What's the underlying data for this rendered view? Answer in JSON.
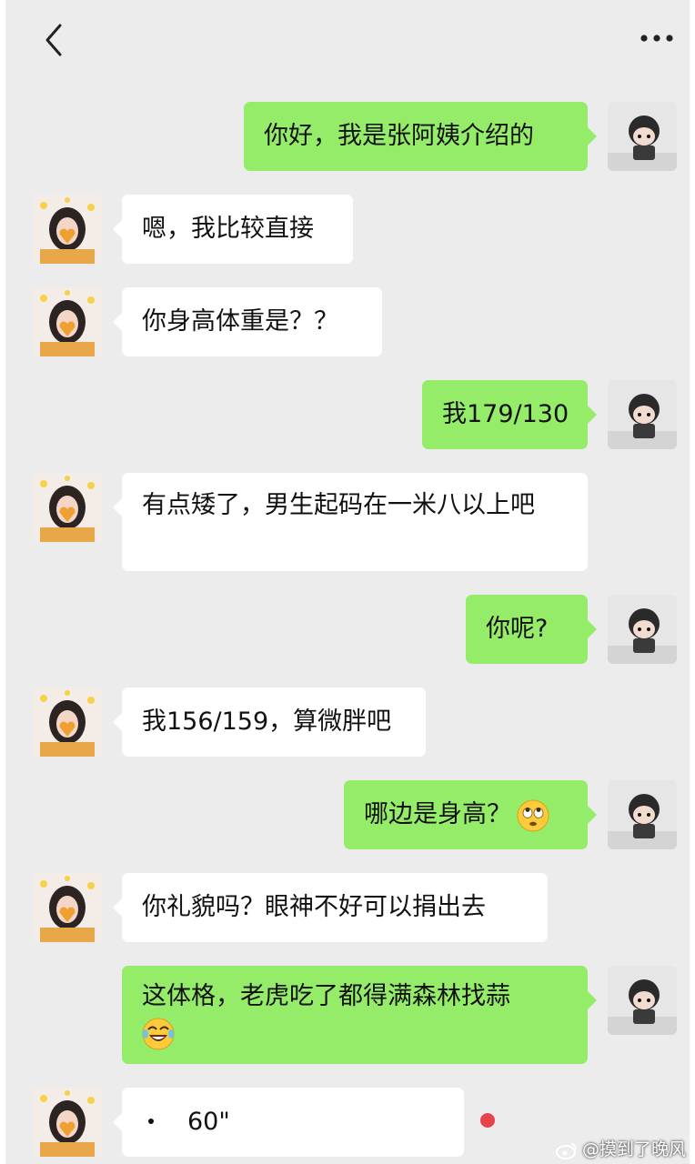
{
  "messages": [
    {
      "text": "你好，我是张阿姨介绍的"
    },
    {
      "text": "嗯，我比较直接"
    },
    {
      "text": "你身高体重是？？"
    },
    {
      "text": "我179/130"
    },
    {
      "text": "有点矮了，男生起码在一米八以上吧"
    },
    {
      "text": "你呢?"
    },
    {
      "text": "我156/159，算微胖吧"
    },
    {
      "text": "哪边是身高？"
    },
    {
      "text": "你礼貌吗？眼神不好可以捐出去"
    },
    {
      "text": "这体格，老虎吃了都得满森林找蒜"
    }
  ],
  "voice": {
    "duration": "60\""
  },
  "watermark": "@摸到了晚风",
  "icons": {
    "back": "chevron-left-icon",
    "more": "more-horizontal-icon",
    "eye_roll": "eye-roll-emoji",
    "laugh": "laugh-cry-emoji"
  },
  "colors": {
    "background": "#ececec",
    "outgoing_bubble": "#95ec69",
    "incoming_bubble": "#ffffff"
  }
}
